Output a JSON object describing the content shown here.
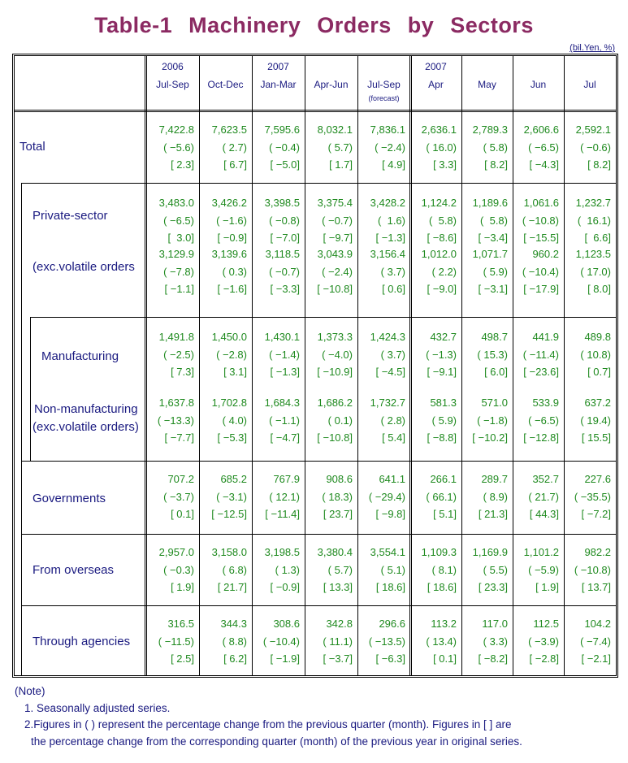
{
  "title": "Table-1  Machinery  Orders  by  Sectors",
  "unit": "(bil.Yen, %)",
  "columns": [
    {
      "year": "2006",
      "period": "Jul-Sep",
      "note": ""
    },
    {
      "year": "",
      "period": "Oct-Dec",
      "note": ""
    },
    {
      "year": "2007",
      "period": "Jan-Mar",
      "note": ""
    },
    {
      "year": "",
      "period": "Apr-Jun",
      "note": ""
    },
    {
      "year": "",
      "period": "Jul-Sep",
      "note": "(forecast)"
    },
    {
      "year": "2007",
      "period": "Apr",
      "note": ""
    },
    {
      "year": "",
      "period": "May",
      "note": ""
    },
    {
      "year": "",
      "period": "Jun",
      "note": ""
    },
    {
      "year": "",
      "period": "Jul",
      "note": ""
    }
  ],
  "rows": [
    {
      "label": "Total",
      "label2": "",
      "values": [
        "7,422.8",
        "7,623.5",
        "7,595.6",
        "8,032.1",
        "7,836.1",
        "2,636.1",
        "2,789.3",
        "2,606.6",
        "2,592.1"
      ],
      "qoq": [
        "( −5.6)",
        "( 2.7)",
        "( −0.4)",
        "( 5.7)",
        "( −2.4)",
        "( 16.0)",
        "( 5.8)",
        "( −6.5)",
        "( −0.6)"
      ],
      "yoy": [
        "[ 2.3]",
        "[ 6.7]",
        "[ −5.0]",
        "[ 1.7]",
        "[ 4.9]",
        "[ 3.3]",
        "[ 8.2]",
        "[ −4.3]",
        "[ 8.2]"
      ]
    },
    {
      "label": "Private-sector",
      "label2": "",
      "values": [
        "3,483.0",
        "3,426.2",
        "3,398.5",
        "3,375.4",
        "3,428.2",
        "1,124.2",
        "1,189.6",
        "1,061.6",
        "1,232.7"
      ],
      "qoq": [
        "( −6.5)",
        "( −1.6)",
        "( −0.8)",
        "( −0.7)",
        "(  1.6)",
        "(  5.8)",
        "(  5.8)",
        "( −10.8)",
        "(  16.1)"
      ],
      "yoy": [
        "[  3.0]",
        "[ −0.9]",
        "[ −7.0]",
        "[ −9.7]",
        "[ −1.3]",
        "[ −8.6]",
        "[ −3.4]",
        "[ −15.5]",
        "[  6.6]"
      ]
    },
    {
      "label": "(exc.volatile orders",
      "label2": "",
      "values": [
        "3,129.9",
        "3,139.6",
        "3,118.5",
        "3,043.9",
        "3,156.4",
        "1,012.0",
        "1,071.7",
        "960.2",
        "1,123.5"
      ],
      "qoq": [
        "( −7.8)",
        "( 0.3)",
        "( −0.7)",
        "( −2.4)",
        "( 3.7)",
        "( 2.2)",
        "( 5.9)",
        "( −10.4)",
        "( 17.0)"
      ],
      "yoy": [
        "[ −1.1]",
        "[ −1.6]",
        "[ −3.3]",
        "[ −10.8]",
        "[ 0.6]",
        "[ −9.0]",
        "[ −3.1]",
        "[ −17.9]",
        "[ 8.0]"
      ]
    },
    {
      "label": "Manufacturing",
      "label2": "",
      "values": [
        "1,491.8",
        "1,450.0",
        "1,430.1",
        "1,373.3",
        "1,424.3",
        "432.7",
        "498.7",
        "441.9",
        "489.8"
      ],
      "qoq": [
        "( −2.5)",
        "( −2.8)",
        "( −1.4)",
        "( −4.0)",
        "( 3.7)",
        "( −1.3)",
        "( 15.3)",
        "( −11.4)",
        "( 10.8)"
      ],
      "yoy": [
        "[ 7.3]",
        "[ 3.1]",
        "[ −1.3]",
        "[ −10.9]",
        "[ −4.5]",
        "[ −9.1]",
        "[ 6.0]",
        "[ −23.6]",
        "[ 0.7]"
      ]
    },
    {
      "label": "Non-manufacturing",
      "label2": "(exc.volatile orders)",
      "values": [
        "1,637.8",
        "1,702.8",
        "1,684.3",
        "1,686.2",
        "1,732.7",
        "581.3",
        "571.0",
        "533.9",
        "637.2"
      ],
      "qoq": [
        "( −13.3)",
        "( 4.0)",
        "( −1.1)",
        "( 0.1)",
        "( 2.8)",
        "( 5.9)",
        "( −1.8)",
        "( −6.5)",
        "( 19.4)"
      ],
      "yoy": [
        "[ −7.7]",
        "[ −5.3]",
        "[ −4.7]",
        "[ −10.8]",
        "[ 5.4]",
        "[ −8.8]",
        "[ −10.2]",
        "[ −12.8]",
        "[ 15.5]"
      ]
    },
    {
      "label": "Governments",
      "label2": "",
      "values": [
        "707.2",
        "685.2",
        "767.9",
        "908.6",
        "641.1",
        "266.1",
        "289.7",
        "352.7",
        "227.6"
      ],
      "qoq": [
        "( −3.7)",
        "( −3.1)",
        "( 12.1)",
        "( 18.3)",
        "( −29.4)",
        "( 66.1)",
        "( 8.9)",
        "( 21.7)",
        "( −35.5)"
      ],
      "yoy": [
        "[ 0.1]",
        "[ −12.5]",
        "[ −11.4]",
        "[ 23.7]",
        "[ −9.8]",
        "[ 5.1]",
        "[ 21.3]",
        "[ 44.3]",
        "[ −7.2]"
      ]
    },
    {
      "label": "From overseas",
      "label2": "",
      "values": [
        "2,957.0",
        "3,158.0",
        "3,198.5",
        "3,380.4",
        "3,554.1",
        "1,109.3",
        "1,169.9",
        "1,101.2",
        "982.2"
      ],
      "qoq": [
        "( −0.3)",
        "( 6.8)",
        "( 1.3)",
        "( 5.7)",
        "( 5.1)",
        "( 8.1)",
        "( 5.5)",
        "( −5.9)",
        "( −10.8)"
      ],
      "yoy": [
        "[ 1.9]",
        "[ 21.7]",
        "[ −0.9]",
        "[ 13.3]",
        "[ 18.6]",
        "[ 18.6]",
        "[ 23.3]",
        "[ 1.9]",
        "[ 13.7]"
      ]
    },
    {
      "label": "Through agencies",
      "label2": "",
      "values": [
        "316.5",
        "344.3",
        "308.6",
        "342.8",
        "296.6",
        "113.2",
        "117.0",
        "112.5",
        "104.2"
      ],
      "qoq": [
        "( −11.5)",
        "( 8.8)",
        "( −10.4)",
        "( 11.1)",
        "( −13.5)",
        "( 13.4)",
        "( 3.3)",
        "( −3.9)",
        "( −7.4)"
      ],
      "yoy": [
        "[ 2.5]",
        "[ 6.2]",
        "[ −1.9]",
        "[ −3.7]",
        "[ −6.3]",
        "[ 0.1]",
        "[ −8.2]",
        "[ −2.8]",
        "[ −2.1]"
      ]
    }
  ],
  "notes": {
    "heading": "(Note)",
    "line1": "1. Seasonally adjusted series.",
    "line2": "2.Figures in ( ) represent the percentage change from the previous quarter (month). Figures in [ ] are",
    "line3": "the percentage change from the corresponding quarter (month) of the previous year in original series."
  },
  "colors": {
    "title": "#8b2a62",
    "label": "#1a1a80",
    "value": "#1f8a1f"
  }
}
